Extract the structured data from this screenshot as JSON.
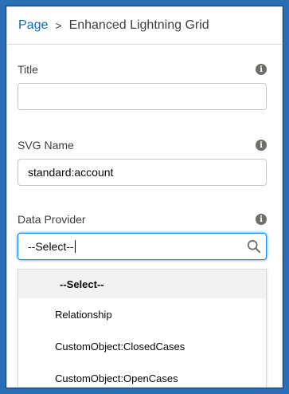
{
  "breadcrumb": {
    "parent": "Page",
    "separator": ">",
    "current": "Enhanced Lightning Grid"
  },
  "fields": [
    {
      "label": "Title",
      "value": "",
      "info_icon": "info-icon"
    },
    {
      "label": "SVG Name",
      "value": "standard:account",
      "info_icon": "info-icon"
    },
    {
      "label": "Data Provider",
      "value": "--Select--",
      "info_icon": "info-icon",
      "trailing_icon": "search-icon"
    }
  ],
  "dropdown": {
    "options": [
      "--Select--",
      "Relationship",
      "CustomObject:ClosedCases",
      "CustomObject:OpenCases"
    ],
    "selected": "--Select--"
  },
  "colors": {
    "frame": "#2a6fb5",
    "link": "#006dcc",
    "focus": "#1589ee"
  }
}
